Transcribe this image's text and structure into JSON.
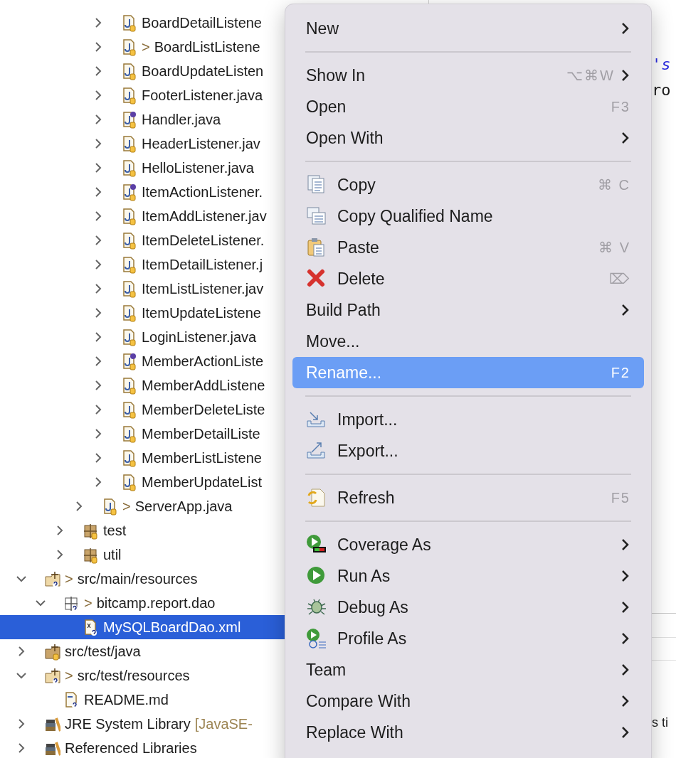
{
  "tree": {
    "nodes": [
      {
        "children": [
          {
            "children": [
              {
                "children": [
                  {
                    "children": [
                      {
                        "label": "BoardDetailListene",
                        "kind": "java-class",
                        "expanded": false,
                        "selected": false
                      },
                      {
                        "label": "BoardListListene",
                        "prefix": ">",
                        "kind": "java-class",
                        "expanded": false,
                        "selected": false
                      },
                      {
                        "label": "BoardUpdateListen",
                        "kind": "java-class",
                        "expanded": false,
                        "selected": false
                      },
                      {
                        "label": "FooterListener.java",
                        "kind": "java-class",
                        "expanded": false,
                        "selected": false
                      },
                      {
                        "label": "Handler.java",
                        "kind": "java-interface",
                        "expanded": false,
                        "selected": false
                      },
                      {
                        "label": "HeaderListener.jav",
                        "kind": "java-class",
                        "expanded": false,
                        "selected": false
                      },
                      {
                        "label": "HelloListener.java",
                        "kind": "java-class",
                        "expanded": false,
                        "selected": false
                      },
                      {
                        "label": "ItemActionListener.",
                        "kind": "java-interface",
                        "expanded": false,
                        "selected": false
                      },
                      {
                        "label": "ItemAddListener.jav",
                        "kind": "java-class",
                        "expanded": false,
                        "selected": false
                      },
                      {
                        "label": "ItemDeleteListener.",
                        "kind": "java-class",
                        "expanded": false,
                        "selected": false
                      },
                      {
                        "label": "ItemDetailListener.j",
                        "kind": "java-class",
                        "expanded": false,
                        "selected": false
                      },
                      {
                        "label": "ItemListListener.jav",
                        "kind": "java-class",
                        "expanded": false,
                        "selected": false
                      },
                      {
                        "label": "ItemUpdateListene",
                        "kind": "java-class",
                        "expanded": false,
                        "selected": false
                      },
                      {
                        "label": "LoginListener.java",
                        "kind": "java-class",
                        "expanded": false,
                        "selected": false
                      },
                      {
                        "label": "MemberActionListe",
                        "kind": "java-interface",
                        "expanded": false,
                        "selected": false
                      },
                      {
                        "label": "MemberAddListene",
                        "kind": "java-class",
                        "expanded": false,
                        "selected": false
                      },
                      {
                        "label": "MemberDeleteListe",
                        "kind": "java-class",
                        "expanded": false,
                        "selected": false
                      },
                      {
                        "label": "MemberDetailListe",
                        "kind": "java-class",
                        "expanded": false,
                        "selected": false
                      },
                      {
                        "label": "MemberListListene",
                        "kind": "java-class",
                        "expanded": false,
                        "selected": false
                      },
                      {
                        "label": "MemberUpdateList",
                        "kind": "java-class",
                        "expanded": false,
                        "selected": false
                      }
                    ]
                  },
                  {
                    "label": "ServerApp.java",
                    "prefix": ">",
                    "kind": "java-class",
                    "expanded": false,
                    "selected": false
                  }
                ]
              },
              {
                "label": "test",
                "kind": "package",
                "expanded": false,
                "selected": false
              },
              {
                "label": "util",
                "kind": "package",
                "expanded": false,
                "selected": false
              }
            ]
          }
        ]
      },
      {
        "label": "src/main/resources",
        "prefix": ">",
        "kind": "source-folder-unknown",
        "expanded": true,
        "selected": false,
        "children": [
          {
            "label": "bitcamp.report.dao",
            "prefix": ">",
            "kind": "package-unknown",
            "expanded": true,
            "selected": false,
            "children": [
              {
                "label": "MySQLBoardDao.xml",
                "kind": "xml-file",
                "selected": true
              }
            ]
          }
        ]
      },
      {
        "label": "src/test/java",
        "kind": "source-folder",
        "expanded": false,
        "selected": false
      },
      {
        "label": "src/test/resources",
        "prefix": ">",
        "kind": "source-folder-unknown",
        "expanded": true,
        "selected": false,
        "children": [
          {
            "label": "README.md",
            "kind": "md-file",
            "selected": false
          }
        ]
      },
      {
        "label": "JRE System Library",
        "qualifier": "[JavaSE-",
        "kind": "library",
        "expanded": false,
        "selected": false
      },
      {
        "label": "Referenced Libraries",
        "kind": "library",
        "expanded": false,
        "selected": false
      }
    ]
  },
  "editor": {
    "fragments": [
      {
        "kind": "string",
        "text": "'s"
      },
      {
        "kind": "code",
        "text": "ro"
      },
      {
        "kind": "console",
        "text": "s ti"
      }
    ]
  },
  "context_menu": {
    "items": [
      {
        "kind": "item",
        "label": "New",
        "submenu": true,
        "selected": false
      },
      {
        "kind": "separator"
      },
      {
        "kind": "item",
        "label": "Show In",
        "shortcut": "⌥⌘W",
        "submenu": true,
        "selected": false
      },
      {
        "kind": "item",
        "label": "Open",
        "shortcut": "F3",
        "submenu": false,
        "selected": false
      },
      {
        "kind": "item",
        "label": "Open With",
        "submenu": true,
        "selected": false
      },
      {
        "kind": "separator"
      },
      {
        "kind": "copy",
        "label": "Copy",
        "shortcut": "⌘ C",
        "submenu": false,
        "selected": false
      },
      {
        "kind": "qualified",
        "label": "Copy Qualified Name",
        "submenu": false,
        "selected": false
      },
      {
        "kind": "paste",
        "label": "Paste",
        "shortcut": "⌘ V",
        "submenu": false,
        "selected": false
      },
      {
        "kind": "delete",
        "label": "Delete",
        "shortcut": "⌦",
        "submenu": false,
        "selected": false
      },
      {
        "kind": "item",
        "label": "Build Path",
        "submenu": true,
        "selected": false
      },
      {
        "kind": "item",
        "label": "Move...",
        "submenu": false,
        "selected": false
      },
      {
        "kind": "item",
        "label": "Rename...",
        "shortcut": "F2",
        "submenu": false,
        "selected": true
      },
      {
        "kind": "separator"
      },
      {
        "kind": "import",
        "label": "Import...",
        "submenu": false,
        "selected": false
      },
      {
        "kind": "export",
        "label": "Export...",
        "submenu": false,
        "selected": false
      },
      {
        "kind": "separator"
      },
      {
        "kind": "refresh",
        "label": "Refresh",
        "shortcut": "F5",
        "submenu": false,
        "selected": false
      },
      {
        "kind": "separator"
      },
      {
        "kind": "coverage",
        "label": "Coverage As",
        "submenu": true,
        "selected": false
      },
      {
        "kind": "run",
        "label": "Run As",
        "submenu": true,
        "selected": false
      },
      {
        "kind": "debug",
        "label": "Debug As",
        "submenu": true,
        "selected": false
      },
      {
        "kind": "profile",
        "label": "Profile As",
        "submenu": true,
        "selected": false
      },
      {
        "kind": "item",
        "label": "Team",
        "submenu": true,
        "selected": false
      },
      {
        "kind": "item",
        "label": "Compare With",
        "submenu": true,
        "selected": false
      },
      {
        "kind": "item",
        "label": "Replace With",
        "submenu": true,
        "selected": false
      }
    ]
  }
}
